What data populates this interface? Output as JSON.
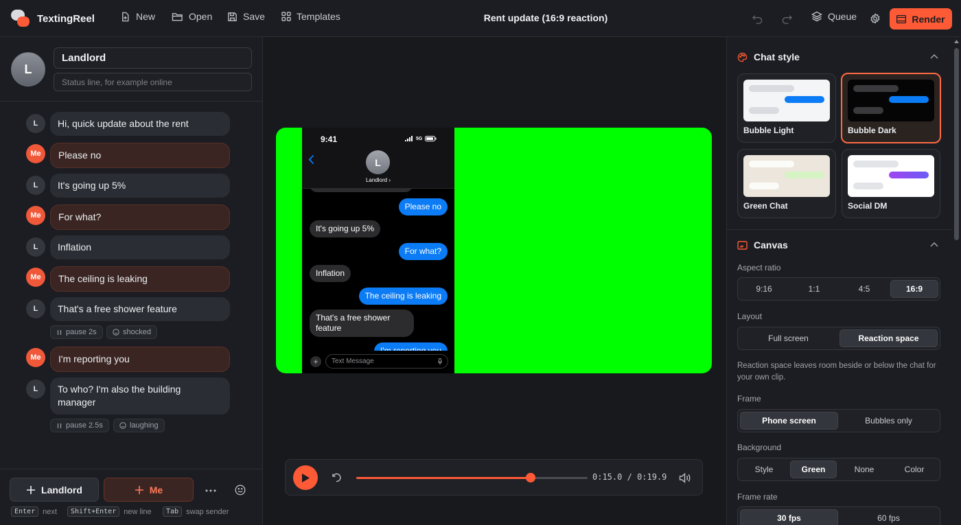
{
  "app": {
    "name": "TextingReel"
  },
  "toolbar": {
    "new": "New",
    "open": "Open",
    "save": "Save",
    "templates": "Templates",
    "doc_title": "Rent update (16:9 reaction)",
    "queue": "Queue",
    "render": "Render"
  },
  "contact": {
    "initial": "L",
    "name": "Landlord",
    "status_placeholder": "Status line, for example online"
  },
  "messages": [
    {
      "sender": "L",
      "text": "Hi, quick update about the rent"
    },
    {
      "sender": "Me",
      "text": "Please no"
    },
    {
      "sender": "L",
      "text": "It's going up 5%"
    },
    {
      "sender": "Me",
      "text": "For what?"
    },
    {
      "sender": "L",
      "text": "Inflation"
    },
    {
      "sender": "Me",
      "text": "The ceiling is leaking"
    },
    {
      "sender": "L",
      "text": "That's a free shower feature",
      "pause": "pause 2s",
      "reaction": "shocked"
    },
    {
      "sender": "Me",
      "text": "I'm reporting you"
    },
    {
      "sender": "L",
      "text": "To who? I'm also the building manager",
      "pause": "pause 2.5s",
      "reaction": "laughing"
    }
  ],
  "composer": {
    "add_landlord": "Landlord",
    "add_me": "Me",
    "hint_enter_key": "Enter",
    "hint_enter": "next",
    "hint_shift_key": "Shift+Enter",
    "hint_shift": "new line",
    "hint_tab_key": "Tab",
    "hint_tab": "swap sender"
  },
  "preview": {
    "time": "9:41",
    "network": "5G",
    "contact_initial": "L",
    "contact_name": "Landlord ›",
    "bubbles": [
      {
        "dir": "out",
        "text": "Please no"
      },
      {
        "dir": "in",
        "text": "It's going up 5%"
      },
      {
        "dir": "out",
        "text": "For what?"
      },
      {
        "dir": "in",
        "text": "Inflation"
      },
      {
        "dir": "out",
        "text": "The ceiling is leaking"
      },
      {
        "dir": "in",
        "text": "That's a free shower feature"
      },
      {
        "dir": "out",
        "text": "I'm reporting you"
      }
    ],
    "input_placeholder": "Text Message",
    "background_color": "#00ff00"
  },
  "player": {
    "current": "0:15.0",
    "sep": "/",
    "total": "0:19.9",
    "progress": 0.754
  },
  "chat_style": {
    "title": "Chat style",
    "options": [
      {
        "label": "Bubble Light",
        "selected": false
      },
      {
        "label": "Bubble Dark",
        "selected": true
      },
      {
        "label": "Green Chat",
        "selected": false
      },
      {
        "label": "Social DM",
        "selected": false
      }
    ]
  },
  "canvas": {
    "title": "Canvas",
    "aspect_label": "Aspect ratio",
    "aspect_options": [
      "9:16",
      "1:1",
      "4:5",
      "16:9"
    ],
    "aspect_selected": "16:9",
    "layout_label": "Layout",
    "layout_options": [
      "Full screen",
      "Reaction space"
    ],
    "layout_selected": "Reaction space",
    "layout_help": "Reaction space leaves room beside or below the chat for your own clip.",
    "frame_label": "Frame",
    "frame_options": [
      "Phone screen",
      "Bubbles only"
    ],
    "frame_selected": "Phone screen",
    "background_label": "Background",
    "background_options": [
      "Style",
      "Green",
      "None",
      "Color"
    ],
    "background_selected": "Green",
    "framerate_label": "Frame rate",
    "framerate_options": [
      "30 fps",
      "60 fps"
    ],
    "framerate_selected": "30 fps"
  },
  "colors": {
    "accent": "#ff5a36",
    "ios_blue": "#0b7cf5",
    "chroma_green": "#00ff00"
  }
}
